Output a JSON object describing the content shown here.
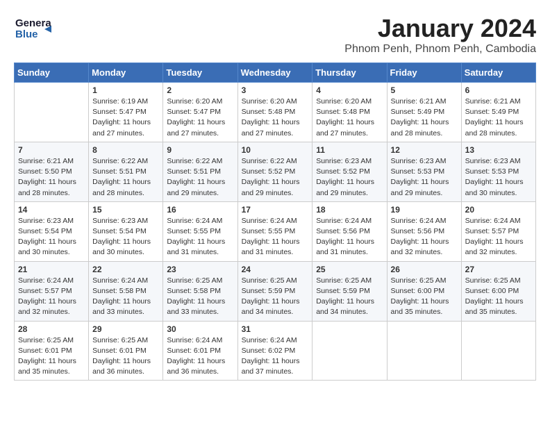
{
  "logo": {
    "line1": "General",
    "line2": "Blue"
  },
  "title": "January 2024",
  "subtitle": "Phnom Penh, Phnom Penh, Cambodia",
  "weekdays": [
    "Sunday",
    "Monday",
    "Tuesday",
    "Wednesday",
    "Thursday",
    "Friday",
    "Saturday"
  ],
  "weeks": [
    [
      {
        "day": "",
        "info": ""
      },
      {
        "day": "1",
        "info": "Sunrise: 6:19 AM\nSunset: 5:47 PM\nDaylight: 11 hours\nand 27 minutes."
      },
      {
        "day": "2",
        "info": "Sunrise: 6:20 AM\nSunset: 5:47 PM\nDaylight: 11 hours\nand 27 minutes."
      },
      {
        "day": "3",
        "info": "Sunrise: 6:20 AM\nSunset: 5:48 PM\nDaylight: 11 hours\nand 27 minutes."
      },
      {
        "day": "4",
        "info": "Sunrise: 6:20 AM\nSunset: 5:48 PM\nDaylight: 11 hours\nand 27 minutes."
      },
      {
        "day": "5",
        "info": "Sunrise: 6:21 AM\nSunset: 5:49 PM\nDaylight: 11 hours\nand 28 minutes."
      },
      {
        "day": "6",
        "info": "Sunrise: 6:21 AM\nSunset: 5:49 PM\nDaylight: 11 hours\nand 28 minutes."
      }
    ],
    [
      {
        "day": "7",
        "info": "Sunrise: 6:21 AM\nSunset: 5:50 PM\nDaylight: 11 hours\nand 28 minutes."
      },
      {
        "day": "8",
        "info": "Sunrise: 6:22 AM\nSunset: 5:51 PM\nDaylight: 11 hours\nand 28 minutes."
      },
      {
        "day": "9",
        "info": "Sunrise: 6:22 AM\nSunset: 5:51 PM\nDaylight: 11 hours\nand 29 minutes."
      },
      {
        "day": "10",
        "info": "Sunrise: 6:22 AM\nSunset: 5:52 PM\nDaylight: 11 hours\nand 29 minutes."
      },
      {
        "day": "11",
        "info": "Sunrise: 6:23 AM\nSunset: 5:52 PM\nDaylight: 11 hours\nand 29 minutes."
      },
      {
        "day": "12",
        "info": "Sunrise: 6:23 AM\nSunset: 5:53 PM\nDaylight: 11 hours\nand 29 minutes."
      },
      {
        "day": "13",
        "info": "Sunrise: 6:23 AM\nSunset: 5:53 PM\nDaylight: 11 hours\nand 30 minutes."
      }
    ],
    [
      {
        "day": "14",
        "info": "Sunrise: 6:23 AM\nSunset: 5:54 PM\nDaylight: 11 hours\nand 30 minutes."
      },
      {
        "day": "15",
        "info": "Sunrise: 6:23 AM\nSunset: 5:54 PM\nDaylight: 11 hours\nand 30 minutes."
      },
      {
        "day": "16",
        "info": "Sunrise: 6:24 AM\nSunset: 5:55 PM\nDaylight: 11 hours\nand 31 minutes."
      },
      {
        "day": "17",
        "info": "Sunrise: 6:24 AM\nSunset: 5:55 PM\nDaylight: 11 hours\nand 31 minutes."
      },
      {
        "day": "18",
        "info": "Sunrise: 6:24 AM\nSunset: 5:56 PM\nDaylight: 11 hours\nand 31 minutes."
      },
      {
        "day": "19",
        "info": "Sunrise: 6:24 AM\nSunset: 5:56 PM\nDaylight: 11 hours\nand 32 minutes."
      },
      {
        "day": "20",
        "info": "Sunrise: 6:24 AM\nSunset: 5:57 PM\nDaylight: 11 hours\nand 32 minutes."
      }
    ],
    [
      {
        "day": "21",
        "info": "Sunrise: 6:24 AM\nSunset: 5:57 PM\nDaylight: 11 hours\nand 32 minutes."
      },
      {
        "day": "22",
        "info": "Sunrise: 6:24 AM\nSunset: 5:58 PM\nDaylight: 11 hours\nand 33 minutes."
      },
      {
        "day": "23",
        "info": "Sunrise: 6:25 AM\nSunset: 5:58 PM\nDaylight: 11 hours\nand 33 minutes."
      },
      {
        "day": "24",
        "info": "Sunrise: 6:25 AM\nSunset: 5:59 PM\nDaylight: 11 hours\nand 34 minutes."
      },
      {
        "day": "25",
        "info": "Sunrise: 6:25 AM\nSunset: 5:59 PM\nDaylight: 11 hours\nand 34 minutes."
      },
      {
        "day": "26",
        "info": "Sunrise: 6:25 AM\nSunset: 6:00 PM\nDaylight: 11 hours\nand 35 minutes."
      },
      {
        "day": "27",
        "info": "Sunrise: 6:25 AM\nSunset: 6:00 PM\nDaylight: 11 hours\nand 35 minutes."
      }
    ],
    [
      {
        "day": "28",
        "info": "Sunrise: 6:25 AM\nSunset: 6:01 PM\nDaylight: 11 hours\nand 35 minutes."
      },
      {
        "day": "29",
        "info": "Sunrise: 6:25 AM\nSunset: 6:01 PM\nDaylight: 11 hours\nand 36 minutes."
      },
      {
        "day": "30",
        "info": "Sunrise: 6:24 AM\nSunset: 6:01 PM\nDaylight: 11 hours\nand 36 minutes."
      },
      {
        "day": "31",
        "info": "Sunrise: 6:24 AM\nSunset: 6:02 PM\nDaylight: 11 hours\nand 37 minutes."
      },
      {
        "day": "",
        "info": ""
      },
      {
        "day": "",
        "info": ""
      },
      {
        "day": "",
        "info": ""
      }
    ]
  ]
}
